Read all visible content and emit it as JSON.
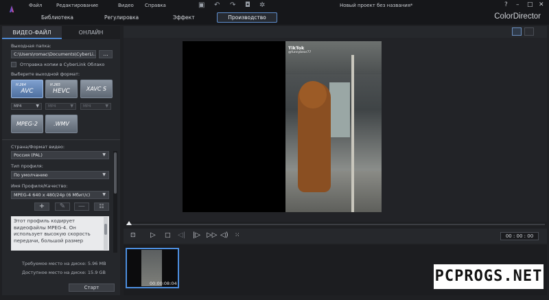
{
  "menu": [
    "Файл",
    "Редактирование",
    "Видео",
    "Справка"
  ],
  "project_title": "Новый проект без названия*",
  "brand": "ColorDirector",
  "tabs": [
    "Библиотека",
    "Регулировка",
    "Эффект",
    "Производство"
  ],
  "panel_tabs": {
    "video_file": "ВИДЕО-ФАЙЛ",
    "online": "ОНЛАЙН"
  },
  "output": {
    "folder_label": "Выходная папка:",
    "folder_value": "C:\\Users\\romac\\Documents\\CyberLi...",
    "browse_label": "...",
    "cloud_checkbox_label": "Отправка копии в CyberLink Облако",
    "cloud_checked": false
  },
  "format": {
    "label": "Выберите выходной формат:",
    "buttons": [
      {
        "top": "H.264",
        "main": "AVC",
        "selected": true
      },
      {
        "top": "H.265",
        "main": "HEVC",
        "selected": false
      },
      {
        "top": "",
        "main": "XAVC S",
        "selected": false
      },
      {
        "top": "",
        "main": "MPEG-2",
        "selected": false
      },
      {
        "top": "",
        "main": ".WMV",
        "selected": false
      }
    ],
    "containers": [
      "MP4",
      "MP4",
      "MP4"
    ]
  },
  "settings": {
    "country_label": "Страна/Формат видео:",
    "country_value": "Россия (PAL)",
    "profile_type_label": "Тип профиля:",
    "profile_type_value": "По умолчанию",
    "profile_name_label": "Имя Профиля/Качество:",
    "profile_name_value": "MPEG-4 640 x 480/24p (6 Мбит/с)",
    "description": "Этот профиль кодирует видеофайлы MPEG-4. Он использует высокую скорость передачи, большой размер"
  },
  "disk": {
    "required": "Требуемое место на диске: 5.96 MB",
    "available": "Доступное место на диске: 15.9 GB"
  },
  "start_label": "Старт",
  "video_overlay": {
    "app": "TikTok",
    "handle": "@funnybear77"
  },
  "timecode": "00 : 00 : 00",
  "clip_timecode": "00:00:08:04",
  "watermark": "PCPROGS.NET",
  "colors": {
    "accent": "#4e88d2",
    "format_selected": "#6b8fc3",
    "background": "#1f2023"
  }
}
